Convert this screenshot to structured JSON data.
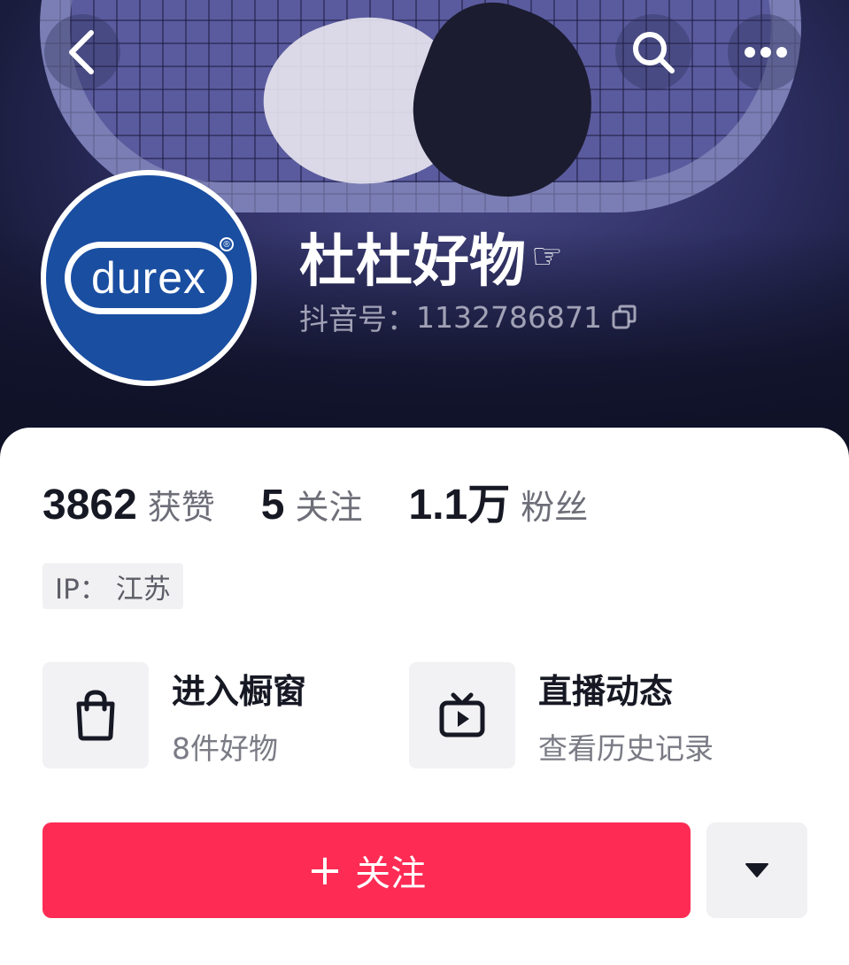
{
  "header": {
    "back_icon": "chevron-left-icon",
    "search_icon": "search-icon",
    "more_icon": "more-horizontal-icon"
  },
  "profile": {
    "avatar_brand": "durex",
    "avatar_registered": "®",
    "name": "杜杜好物",
    "name_emoji": "☞",
    "id_label": "抖音号：",
    "id_value": "1132786871",
    "copy_icon": "copy-icon"
  },
  "stats": [
    {
      "value": "3862",
      "label": "获赞"
    },
    {
      "value": "5",
      "label": "关注"
    },
    {
      "value": "1.1万",
      "label": "粉丝"
    }
  ],
  "ip_tag": "IP：  江苏",
  "features": {
    "shop": {
      "icon": "shopping-bag-icon",
      "title": "进入橱窗",
      "subtitle": "8件好物"
    },
    "live": {
      "icon": "tv-play-icon",
      "title": "直播动态",
      "subtitle": "查看历史记录"
    }
  },
  "actions": {
    "follow_plus": "+",
    "follow_label": "关注",
    "dropdown_icon": "caret-down-icon"
  },
  "colors": {
    "accent": "#fe2c55",
    "brand_blue": "#1a4ea1",
    "text_primary": "#161823",
    "text_secondary": "#6d6e78"
  }
}
